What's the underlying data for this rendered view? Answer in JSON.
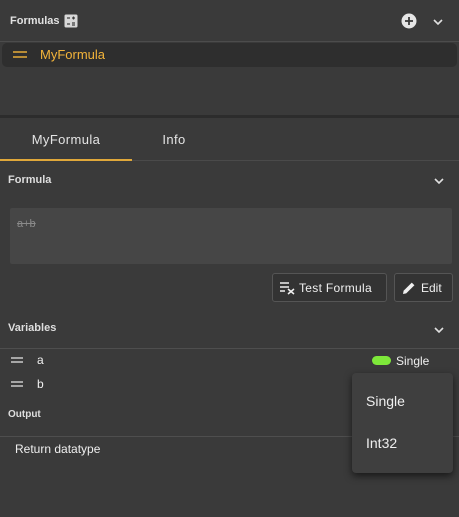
{
  "formulas_panel": {
    "title": "Formulas",
    "icons": [
      "calculator-icon",
      "add-circle-icon",
      "chevron-down-icon"
    ],
    "items": [
      {
        "label": "MyFormula",
        "selected": true,
        "color": "#f3b43a"
      }
    ]
  },
  "tabs": [
    {
      "label": "MyFormula",
      "active": true
    },
    {
      "label": "Info",
      "active": false
    }
  ],
  "formula_section": {
    "label": "Formula",
    "expression": "a+b",
    "buttons": {
      "test": "Test Formula",
      "edit": "Edit"
    }
  },
  "variables_section": {
    "label": "Variables",
    "items": [
      {
        "name": "a",
        "type": "Single",
        "type_color": "#7ee83a"
      },
      {
        "name": "b",
        "type": ""
      }
    ]
  },
  "output_section": {
    "label": "Output",
    "return_label": "Return datatype"
  },
  "type_dropdown": {
    "options": [
      "Single",
      "Int32"
    ]
  },
  "colors": {
    "accent": "#e0a83a",
    "background": "#3a3a3a"
  }
}
